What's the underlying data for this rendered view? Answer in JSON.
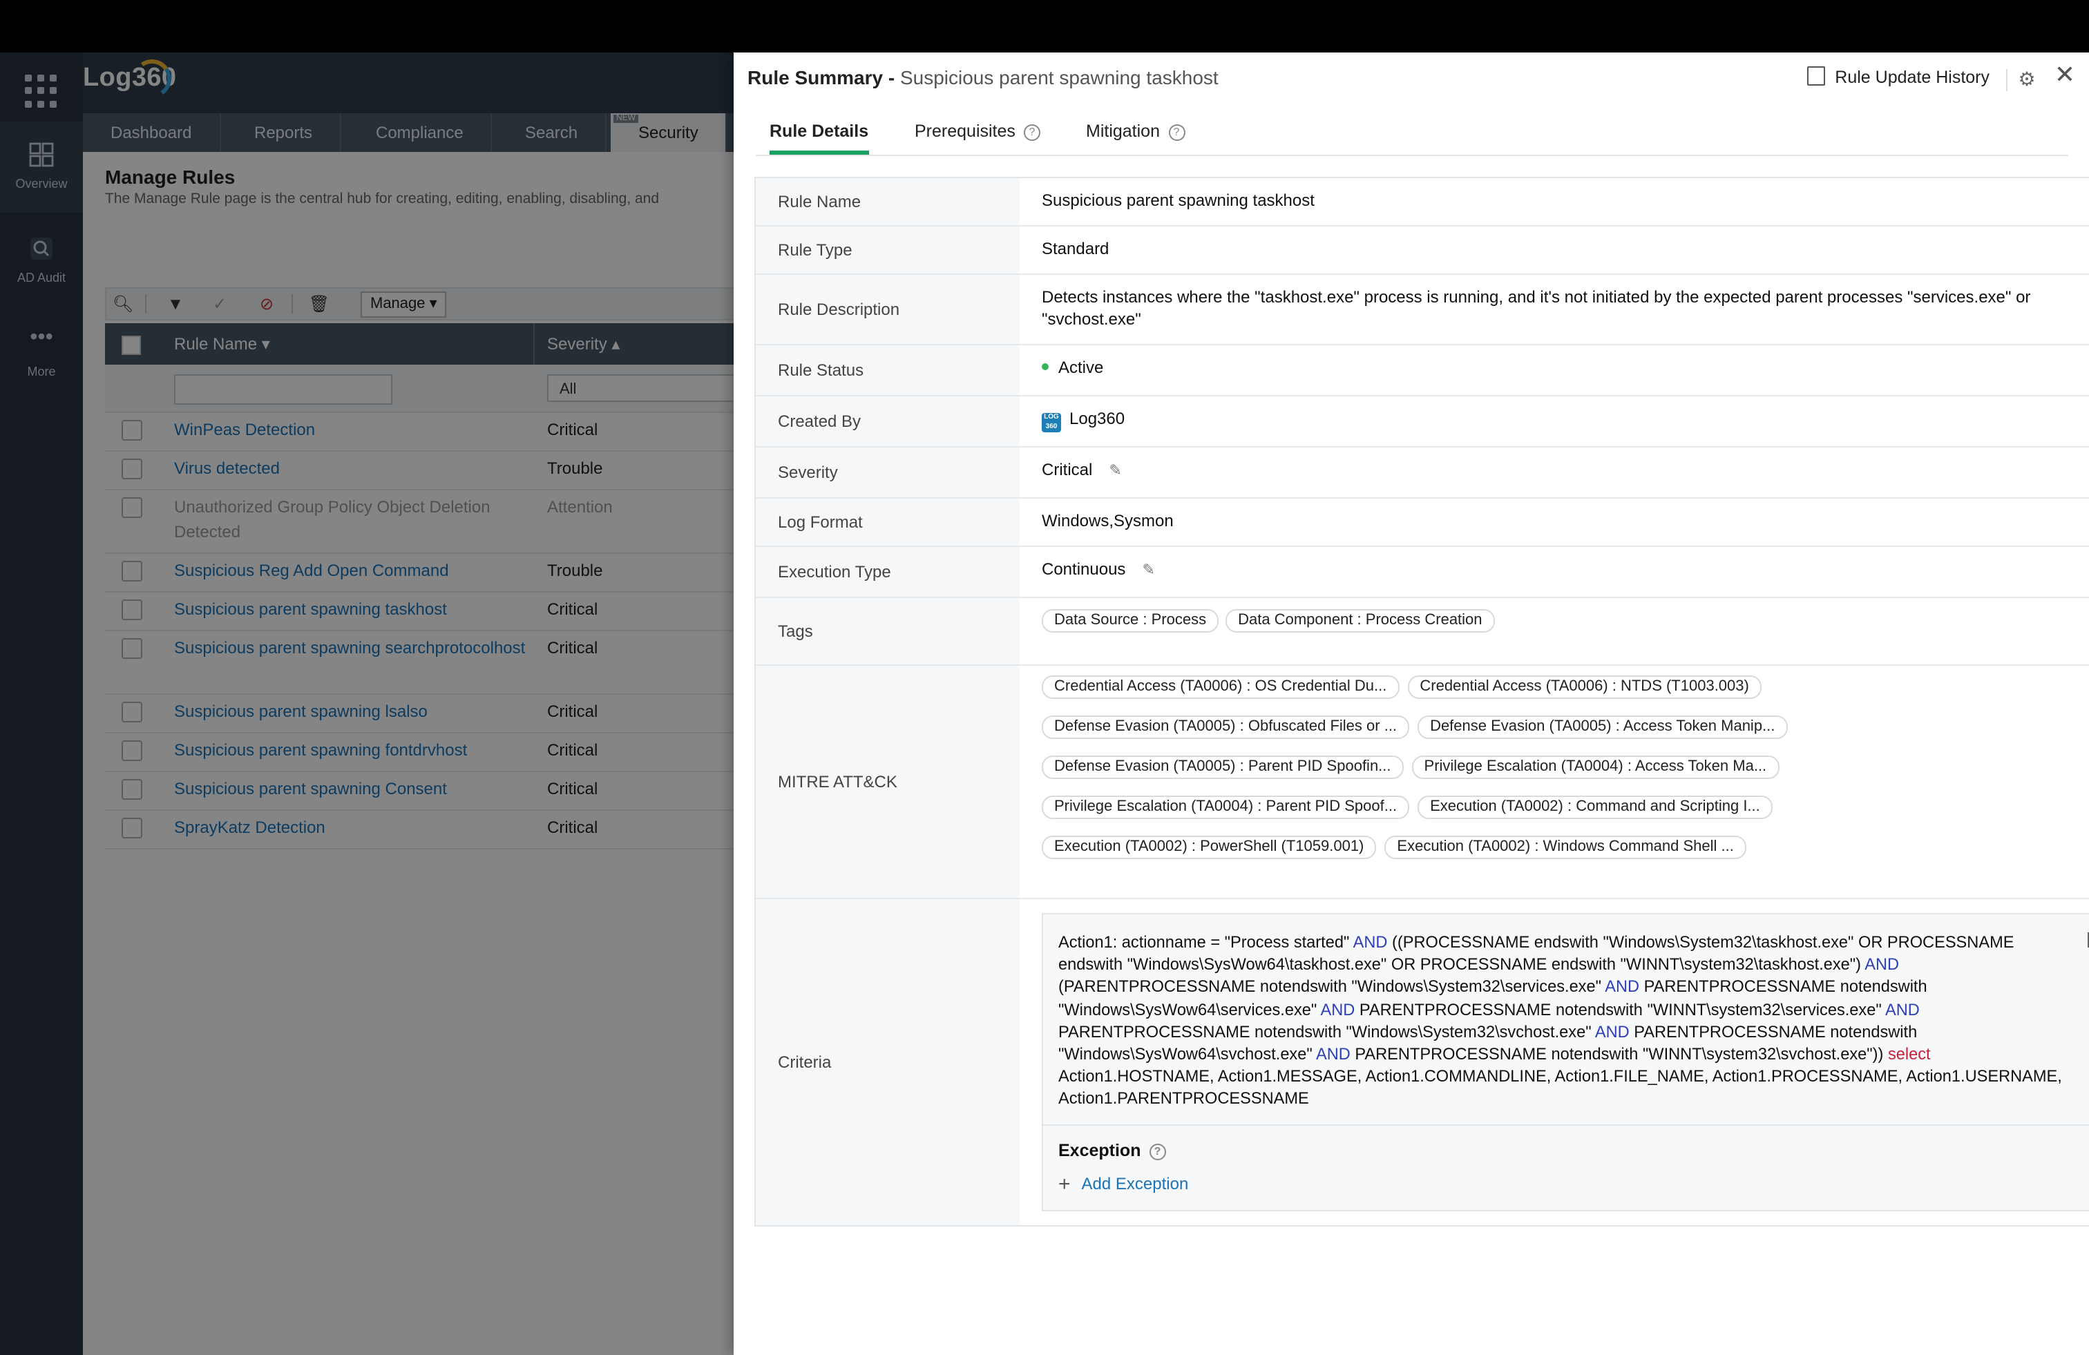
{
  "rail": {
    "items": [
      {
        "label": "Overview"
      },
      {
        "label": "AD Audit"
      },
      {
        "label": "More"
      }
    ]
  },
  "app": {
    "logo": "Log360",
    "tabs": [
      {
        "label": "Dashboard"
      },
      {
        "label": "Reports"
      },
      {
        "label": "Compliance"
      },
      {
        "label": "Search"
      },
      {
        "label": "Security"
      }
    ],
    "new_badge": "NEW",
    "page_title": "Manage Rules",
    "page_subtitle": "The Manage Rule page is the central hub for creating, editing, enabling, disabling, and",
    "toolbar": {
      "manage_label": "Manage"
    },
    "grid": {
      "col_name": "Rule Name",
      "col_severity": "Severity",
      "filter_severity": "All",
      "rows": [
        {
          "name": "WinPeas Detection",
          "severity": "Critical",
          "disabled": false
        },
        {
          "name": "Virus detected",
          "severity": "Trouble",
          "disabled": false
        },
        {
          "name": "Unauthorized Group Policy Object Deletion Detected",
          "severity": "Attention",
          "disabled": true
        },
        {
          "name": "Suspicious Reg Add Open Command",
          "severity": "Trouble",
          "disabled": false
        },
        {
          "name": "Suspicious parent spawning taskhost",
          "severity": "Critical",
          "disabled": false
        },
        {
          "name": "Suspicious parent spawning searchprotocolhost",
          "severity": "Critical",
          "disabled": false
        },
        {
          "name": "Suspicious parent spawning lsalso",
          "severity": "Critical",
          "disabled": false
        },
        {
          "name": "Suspicious parent spawning fontdrvhost",
          "severity": "Critical",
          "disabled": false
        },
        {
          "name": "Suspicious parent spawning Consent",
          "severity": "Critical",
          "disabled": false
        },
        {
          "name": "SprayKatz Detection",
          "severity": "Critical",
          "disabled": false
        }
      ]
    }
  },
  "drawer": {
    "title_prefix": "Rule Summary -",
    "title_rule": "Suspicious parent spawning taskhost",
    "history_label": "Rule Update History",
    "tabs": [
      {
        "label": "Rule Details"
      },
      {
        "label": "Prerequisites"
      },
      {
        "label": "Mitigation"
      }
    ],
    "labels": {
      "rule_name": "Rule Name",
      "rule_type": "Rule Type",
      "rule_description": "Rule Description",
      "rule_status": "Rule Status",
      "created_by": "Created By",
      "severity": "Severity",
      "log_format": "Log Format",
      "execution_type": "Execution Type",
      "tags": "Tags",
      "mitre": "MITRE ATT&CK",
      "criteria": "Criteria"
    },
    "values": {
      "rule_name": "Suspicious parent spawning taskhost",
      "rule_type": "Standard",
      "rule_description": "Detects instances where the \"taskhost.exe\" process is running, and it's not initiated by the expected parent processes \"services.exe\" or \"svchost.exe\"",
      "rule_status": "Active",
      "created_by": "Log360",
      "severity": "Critical",
      "log_format": "Windows,Sysmon",
      "execution_type": "Continuous"
    },
    "created_by_logo": "LOG 360",
    "status_color": "#35b45c",
    "tags": [
      "Data Source : Process",
      "Data Component : Process Creation"
    ],
    "mitre": [
      "Credential Access (TA0006) : OS Credential Du...",
      "Credential Access (TA0006) : NTDS (T1003.003)",
      "Defense Evasion (TA0005) : Obfuscated Files or ...",
      "Defense Evasion (TA0005) : Access Token Manip...",
      "Defense Evasion (TA0005) : Parent PID Spoofin...",
      "Privilege Escalation (TA0004) : Access Token Ma...",
      "Privilege Escalation (TA0004) : Parent PID Spoof...",
      "Execution (TA0002) : Command and Scripting I...",
      "Execution (TA0002) : PowerShell (T1059.001)",
      "Execution (TA0002) : Windows Command Shell ..."
    ],
    "criteria": [
      {
        "t": "Action1: actionname = \"Process started\" ",
        "k": ""
      },
      {
        "t": "AND",
        "k": "kw"
      },
      {
        "t": " ((PROCESSNAME endswith \"Windows\\System32\\taskhost.exe\" OR PROCESSNAME endswith \"Windows\\SysWow64\\taskhost.exe\" OR PROCESSNAME endswith \"WINNT\\system32\\taskhost.exe\") ",
        "k": ""
      },
      {
        "t": "AND",
        "k": "kw"
      },
      {
        "t": " (PARENTPROCESSNAME notendswith \"Windows\\System32\\services.exe\" ",
        "k": ""
      },
      {
        "t": "AND",
        "k": "kw"
      },
      {
        "t": " PARENTPROCESSNAME notendswith \"Windows\\SysWow64\\services.exe\" ",
        "k": ""
      },
      {
        "t": "AND",
        "k": "kw"
      },
      {
        "t": " PARENTPROCESSNAME notendswith \"WINNT\\system32\\services.exe\" ",
        "k": ""
      },
      {
        "t": "AND",
        "k": "kw"
      },
      {
        "t": " PARENTPROCESSNAME notendswith \"Windows\\System32\\svchost.exe\" ",
        "k": ""
      },
      {
        "t": "AND",
        "k": "kw"
      },
      {
        "t": " PARENTPROCESSNAME notendswith \"Windows\\SysWow64\\svchost.exe\" ",
        "k": ""
      },
      {
        "t": "AND",
        "k": "kw"
      },
      {
        "t": " PARENTPROCESSNAME notendswith \"WINNT\\system32\\svchost.exe\")) ",
        "k": ""
      },
      {
        "t": "select",
        "k": "kw2"
      },
      {
        "t": " Action1.HOSTNAME, Action1.MESSAGE, Action1.COMMANDLINE, Action1.FILE_NAME, Action1.PROCESSNAME, Action1.USERNAME, Action1.PARENTPROCESSNAME",
        "k": ""
      }
    ],
    "exception_title": "Exception",
    "add_exception": "Add Exception"
  }
}
